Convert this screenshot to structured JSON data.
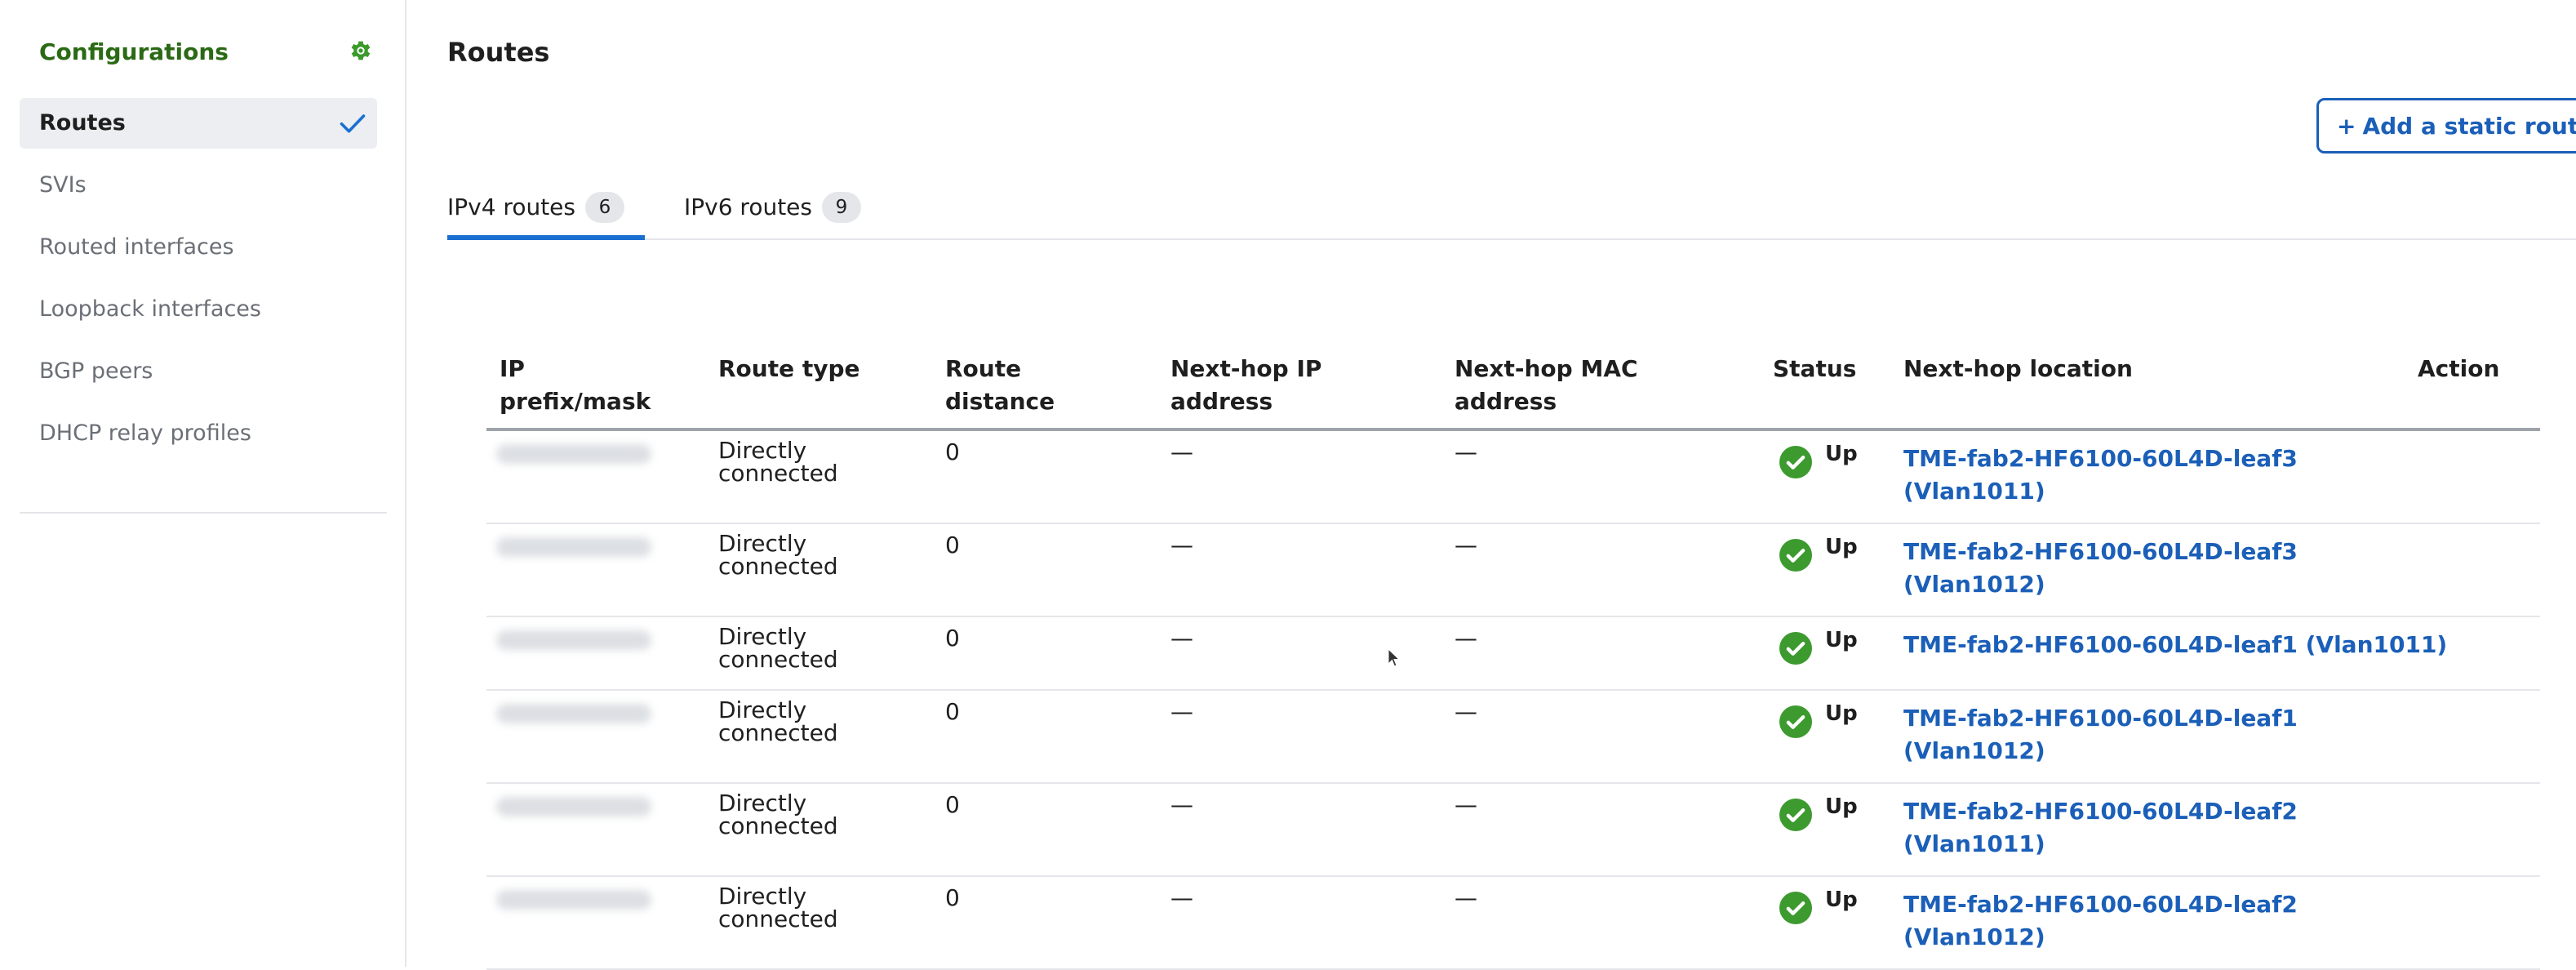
{
  "sidebar": {
    "title": "Configurations",
    "settings_icon": "gear-icon",
    "items": [
      {
        "label": "Routes",
        "active": true
      },
      {
        "label": "SVIs",
        "active": false
      },
      {
        "label": "Routed interfaces",
        "active": false
      },
      {
        "label": "Loopback interfaces",
        "active": false
      },
      {
        "label": "BGP peers",
        "active": false
      },
      {
        "label": "DHCP relay profiles",
        "active": false
      }
    ]
  },
  "main": {
    "title": "Routes",
    "add_button": {
      "plus": "+",
      "label": "Add a static route"
    },
    "tabs": [
      {
        "label": "IPv4 routes",
        "count": "6",
        "active": true
      },
      {
        "label": "IPv6 routes",
        "count": "9",
        "active": false
      }
    ],
    "table": {
      "columns": {
        "ip_prefix_line1": "IP",
        "ip_prefix_line2": "prefix/mask",
        "route_type": "Route type",
        "route_distance_line1": "Route",
        "route_distance_line2": "distance",
        "next_hop_ip_line1": "Next-hop IP",
        "next_hop_ip_line2": "address",
        "next_hop_mac_line1": "Next-hop MAC",
        "next_hop_mac_line2": "address",
        "status": "Status",
        "next_hop_location": "Next-hop location",
        "action": "Action"
      },
      "rows": [
        {
          "route_type_line1": "Directly",
          "route_type_line2": "connected",
          "distance": "0",
          "next_hop_ip": "—",
          "next_hop_mac": "—",
          "status": "Up",
          "location_line1": "TME-fab2-HF6100-60L4D-leaf3",
          "location_line2": "(Vlan1011)"
        },
        {
          "route_type_line1": "Directly",
          "route_type_line2": "connected",
          "distance": "0",
          "next_hop_ip": "—",
          "next_hop_mac": "—",
          "status": "Up",
          "location_line1": "TME-fab2-HF6100-60L4D-leaf3",
          "location_line2": "(Vlan1012)"
        },
        {
          "route_type_line1": "Directly",
          "route_type_line2": "connected",
          "distance": "0",
          "next_hop_ip": "—",
          "next_hop_mac": "—",
          "status": "Up",
          "location_line1": "TME-fab2-HF6100-60L4D-leaf1 (Vlan1011)",
          "location_line2": ""
        },
        {
          "route_type_line1": "Directly",
          "route_type_line2": "connected",
          "distance": "0",
          "next_hop_ip": "—",
          "next_hop_mac": "—",
          "status": "Up",
          "location_line1": "TME-fab2-HF6100-60L4D-leaf1",
          "location_line2": "(Vlan1012)"
        },
        {
          "route_type_line1": "Directly",
          "route_type_line2": "connected",
          "distance": "0",
          "next_hop_ip": "—",
          "next_hop_mac": "—",
          "status": "Up",
          "location_line1": "TME-fab2-HF6100-60L4D-leaf2",
          "location_line2": "(Vlan1011)"
        },
        {
          "route_type_line1": "Directly",
          "route_type_line2": "connected",
          "distance": "0",
          "next_hop_ip": "—",
          "next_hop_mac": "—",
          "status": "Up",
          "location_line1": "TME-fab2-HF6100-60L4D-leaf2",
          "location_line2": "(Vlan1012)"
        }
      ]
    }
  },
  "colors": {
    "brand_green": "#2b6a14",
    "link_blue": "#1b5fb8",
    "tab_underline": "#1b6fd1",
    "status_up": "#3c9a2e"
  }
}
